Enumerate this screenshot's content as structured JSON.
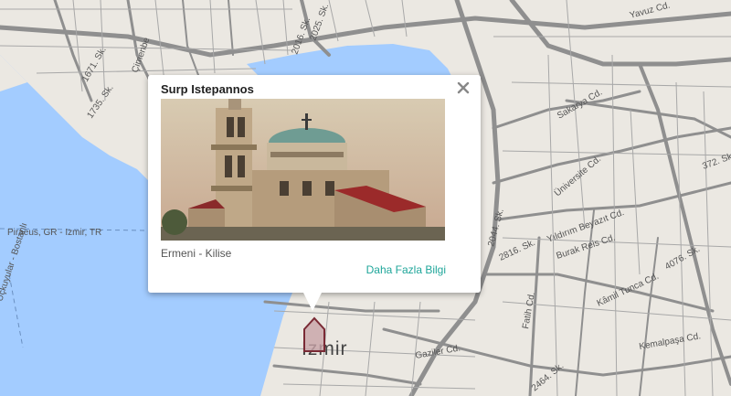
{
  "popup": {
    "title": "Surp Istepannos",
    "category": "Ermeni - Kilise",
    "more_link": "Daha Fazla Bilgi",
    "close_icon": "close-icon"
  },
  "map": {
    "city_label": "İzmir",
    "marker_icon": "church-marker-icon",
    "streets": {
      "sakarya": "Sakarya Cd.",
      "universite": "Üniversite Cd.",
      "yildirim": "Yıldırım Beyazıt Cd.",
      "burak": "Burak Reis Cd.",
      "kamil": "Kâmil Tunca Cd.",
      "kemalpasa": "Kemalpaşa Cd.",
      "gaziler": "Gaziler Cd.",
      "fatih": "Fatih Cd.",
      "yavuz": "Yavuz Cd.",
      "sk1735": "1735. Sk.",
      "sk2816": "2816. Sk.",
      "sk2044": "2044. Sk.",
      "sk2464": "2464. Sk.",
      "sk4076": "4076. Sk.",
      "sk372": "372. Sk.",
      "sk1671": "1671. Sk.",
      "sk2016": "2016. Sk.",
      "sk2025": "2025. Sk.",
      "cimenbe": "Çimenbe",
      "ferry": "Piraeus, GR - Izmir, TR",
      "uckuyular": "Üçkuyular - Bostanlı"
    },
    "colors": {
      "water": "#a3ccff",
      "land": "#ebe8e2",
      "road": "#8f8f8f",
      "accent": "#1fa69a"
    }
  }
}
